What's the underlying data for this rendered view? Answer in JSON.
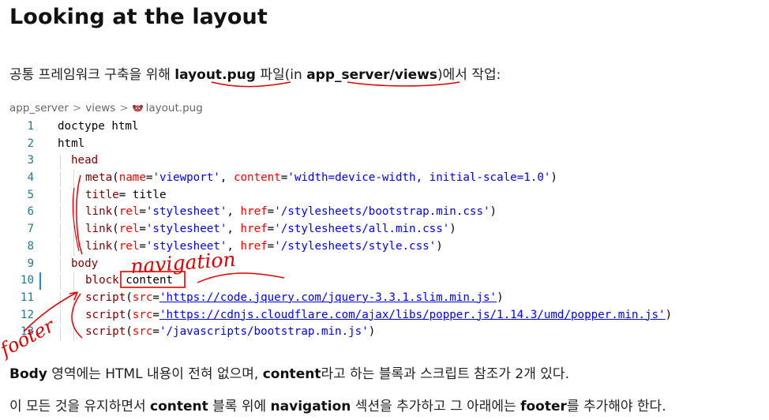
{
  "heading": "Looking at the layout",
  "intro": {
    "pre": "공통 프레임워크 구축을 위해 ",
    "file": "layout.pug",
    "mid": " 파일(in ",
    "path": "app_server/views",
    "post": ")에서 작업:"
  },
  "breadcrumb": {
    "part1": "app_server",
    "sep": ">",
    "part2": "views",
    "file": "layout.pug",
    "file_icon": "pug-icon"
  },
  "code": {
    "lines": [
      {
        "n": "1",
        "t": "doctype html"
      },
      {
        "n": "2",
        "t": "html"
      },
      {
        "n": "3",
        "t": "head"
      },
      {
        "n": "4",
        "t": "meta(name='viewport', content='width=device-width, initial-scale=1.0')"
      },
      {
        "n": "5",
        "t": "title= title"
      },
      {
        "n": "6",
        "t": "link(rel='stylesheet', href='/stylesheets/bootstrap.min.css')"
      },
      {
        "n": "7",
        "t": "link(rel='stylesheet', href='/stylesheets/all.min.css')"
      },
      {
        "n": "8",
        "t": "link(rel='stylesheet', href='/stylesheets/style.css')"
      },
      {
        "n": "9",
        "t": "body"
      },
      {
        "n": "10",
        "t": "block content"
      },
      {
        "n": "11",
        "t": "script(src='https://code.jquery.com/jquery-3.3.1.slim.min.js')"
      },
      {
        "n": "12",
        "t": "script(src='https://cdnjs.cloudflare.com/ajax/libs/popper.js/1.14.3/umd/popper.min.js')"
      },
      {
        "n": "13",
        "t": "script(src='/javascripts/bootstrap.min.js')"
      }
    ]
  },
  "annotations": {
    "navigation": "navigation",
    "footer": "footer",
    "color": "#e00000"
  },
  "para1": {
    "b1": "Body",
    "t1": " 영역에는 HTML 내용이 전혀 없으며, ",
    "b2": "content",
    "t2": "라고 하는 블록과 스크립트 참조가 2개 있다."
  },
  "para2": {
    "t0": "이 모든 것을 유지하면서 ",
    "b1": "content",
    "t1": " 블록 위에 ",
    "b2": "navigation",
    "t2": " 섹션을 추가하고 그 아래에는 ",
    "b3": "footer",
    "t3": "를 추가해야 한다."
  }
}
